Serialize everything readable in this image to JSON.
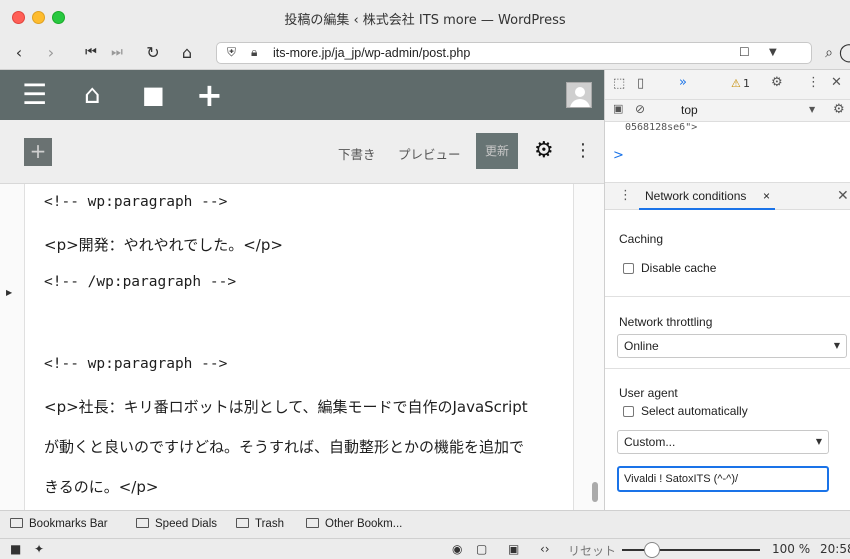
{
  "window": {
    "title": "投稿の編集 ‹ 株式会社 ITS more — WordPress"
  },
  "browser": {
    "url": "its-more.jp/ja_jp/wp-admin/post.php",
    "icons": [
      "back-icon",
      "forward-icon",
      "rewind-icon",
      "fast-forward-icon",
      "reload-icon",
      "home-icon",
      "shield-icon",
      "lock-icon",
      "bookmark-icon",
      "search-icon",
      "profile-icon"
    ]
  },
  "wp_admin_bar": {
    "icons": [
      "menu-icon",
      "home-icon",
      "comment-icon",
      "plus-icon",
      "avatar"
    ]
  },
  "editor_toolbar": {
    "add_label": "+",
    "draft_label": "下書き",
    "preview_label": "プレビュー",
    "update_label": "更新"
  },
  "code_lines": [
    "<!-- wp:paragraph -->",
    "<p>開発：やれやれでした。</p>",
    "<!-- /wp:paragraph -->",
    "<!-- wp:paragraph -->",
    "<p>社長：キリ番ロボットは別として、編集モードで自作のJavaScript",
    "が動くと良いのですけどね。そうすれば、自動整形とかの機能を追加で",
    "きるのに。</p>"
  ],
  "devtools": {
    "more_tabs": "»",
    "warning_count": "1",
    "context": "top",
    "console_snippet": "0568128se6\">",
    "prompt": ">",
    "panel_title": "Network conditions",
    "panel_close": "×",
    "caching_label": "Caching",
    "disable_cache_label": "Disable cache",
    "throttling_label": "Network throttling",
    "throttling_value": "Online",
    "user_agent_label": "User agent",
    "select_auto_label": "Select automatically",
    "ua_select_value": "Custom...",
    "ua_string": "Vivaldi ! SatoxITS (^-^)/"
  },
  "bookmarks": [
    "Bookmarks Bar",
    "Speed Dials",
    "Trash",
    "Other Bookm..."
  ],
  "status": {
    "reset_label": "リセット",
    "zoom": "100 %",
    "time": "20:58"
  }
}
